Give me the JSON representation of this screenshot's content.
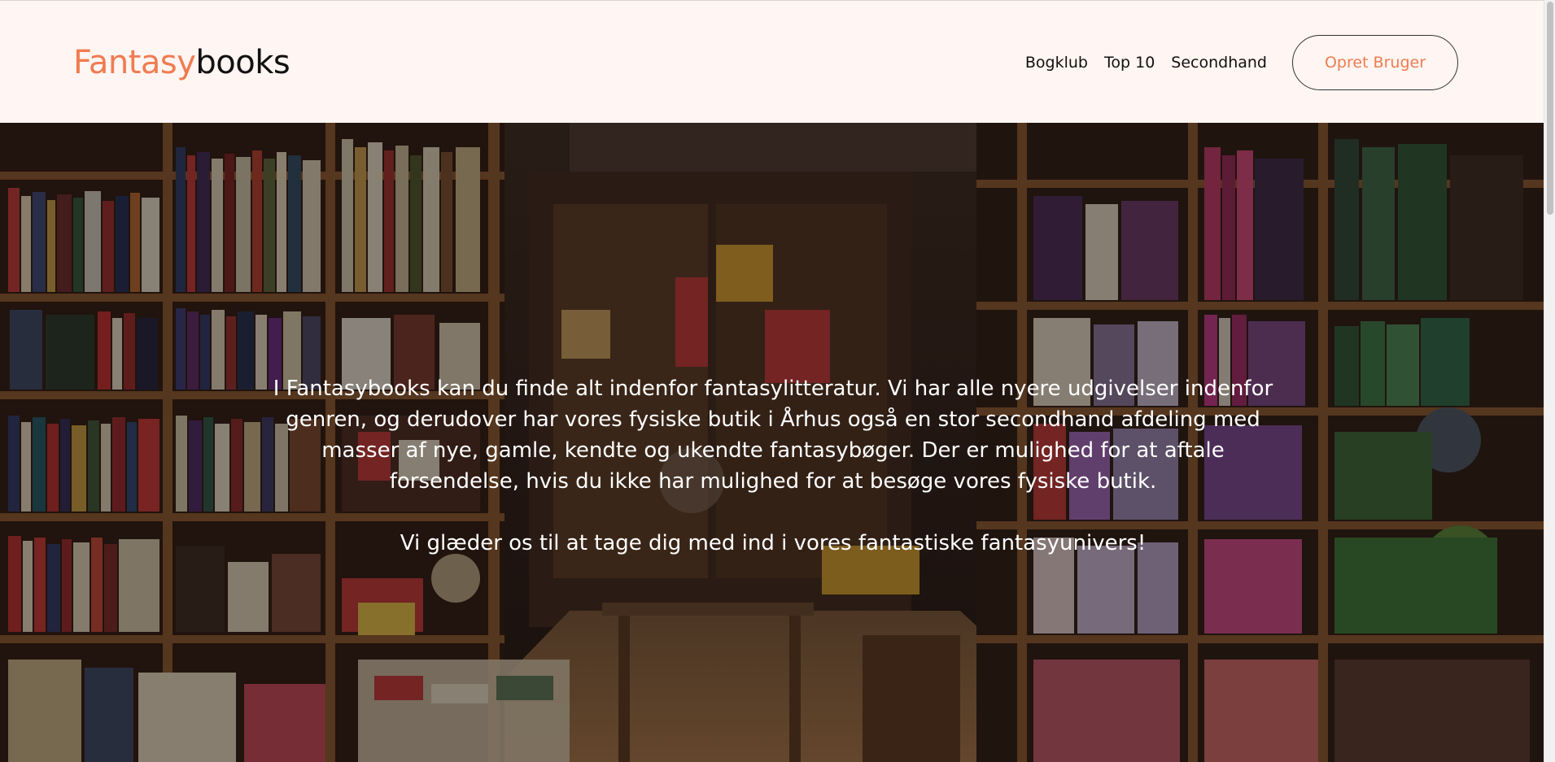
{
  "header": {
    "logo_part1": "Fantasy",
    "logo_part2": "books",
    "nav": [
      {
        "label": "Bogklub"
      },
      {
        "label": "Top 10"
      },
      {
        "label": "Secondhand"
      }
    ],
    "cta_label": "Opret Bruger"
  },
  "hero": {
    "paragraph1": "I Fantasybooks kan du finde alt indenfor fantasylitteratur. Vi har alle nyere udgivelser indenfor genren, og derudover har vores fysiske butik i Århus også en stor secondhand afdeling med masser af nye, gamle, kendte og ukendte fantasybøger. Der er mulighed for at aftale forsendelse, hvis du ikke har mulighed for at besøge vores fysiske butik.",
    "paragraph2": "Vi glæder os til at tage dig med ind i vores fantastiske fantasyunivers!",
    "background_image": "bookstore-photo"
  },
  "colors": {
    "accent": "#f07c50",
    "header_bg": "#fff5f2",
    "text_dark": "#111111",
    "hero_text": "#ffffff"
  }
}
